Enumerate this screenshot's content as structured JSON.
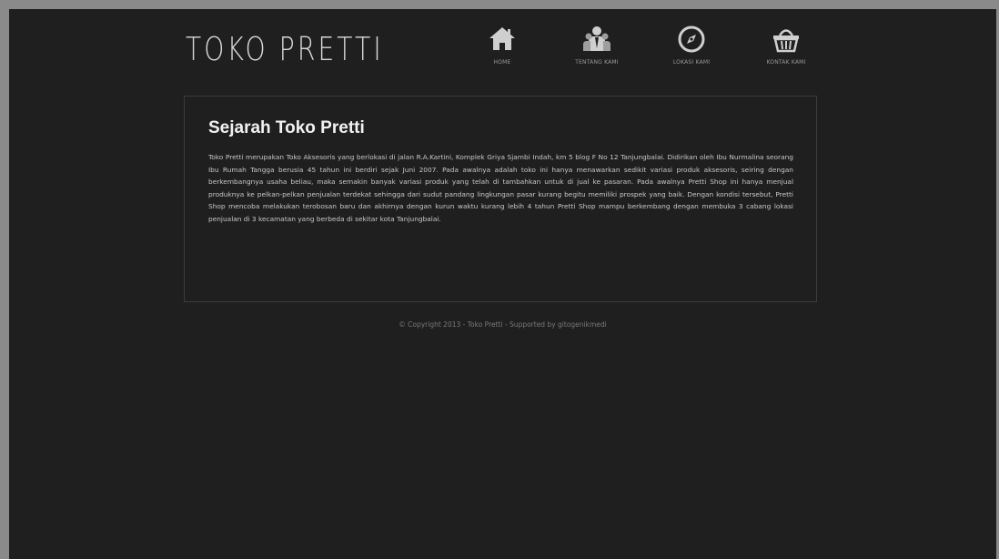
{
  "brand": {
    "logo_text": "TOKO PRETTI"
  },
  "nav": {
    "items": [
      {
        "label": "HOME",
        "icon": "home-icon"
      },
      {
        "label": "TENTANG KAMI",
        "icon": "users-icon"
      },
      {
        "label": "LOKASI KAMI",
        "icon": "compass-icon"
      },
      {
        "label": "KONTAK KAMI",
        "icon": "basket-icon"
      }
    ]
  },
  "main": {
    "title": "Sejarah Toko Pretti",
    "body": "Toko Pretti merupakan Toko Aksesoris yang berlokasi di jalan R.A.Kartini, Komplek Griya Sjambi Indah, km 5 blog F No 12 Tanjungbalai. Didirikan oleh Ibu Nurmalina seorang Ibu Rumah Tangga berusia 45 tahun ini berdiri sejak Juni 2007. Pada awalnya adalah toko ini hanya menawarkan sedikit variasi produk aksesoris, seiring dengan berkembangnya usaha beliau, maka semakin banyak variasi produk yang telah di tambahkan untuk di jual ke pasaran. Pada awalnya Pretti Shop ini hanya menjual produknya ke pelkan-pelkan penjualan terdekat sehingga dari sudut pandang lingkungan pasar kurang begitu memiliki prospek yang baik. Dengan kondisi tersebut, Pretti Shop mencoba melakukan terobosan baru dan akhirnya dengan kurun waktu kurang lebih 4 tahun Pretti Shop mampu berkembang dengan membuka 3 cabang lokasi penjualan di 3 kecamatan yang berbeda di sekitar kota Tanjungbalai."
  },
  "footer": {
    "text": "© Copyright 2013 - Toko Pretti - Supported by gitogenikmedi"
  },
  "colors": {
    "page_bg": "#1f1f1f",
    "outer_bg": "#8a8a8a",
    "text": "#c9c9c9",
    "title": "#f2f2f2"
  }
}
